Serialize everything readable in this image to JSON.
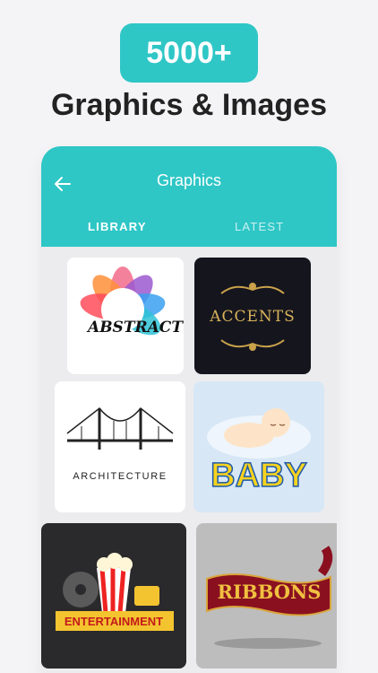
{
  "promo": {
    "badge": "5000+",
    "headline": "Graphics & Images"
  },
  "appbar": {
    "title": "Graphics",
    "back_icon": "arrow-left-icon",
    "tabs": [
      {
        "label": "LIBRARY",
        "active": true
      },
      {
        "label": "LATEST",
        "active": false
      }
    ]
  },
  "tiles": [
    {
      "label": "ABSTRACT"
    },
    {
      "label": "ACCENTS"
    },
    {
      "label": "ARCHITECTURE"
    },
    {
      "label": "BABY"
    },
    {
      "label": "ENTERTAINMENT"
    },
    {
      "label": "RIBBONS"
    }
  ],
  "colors": {
    "accent": "#2fc6c6",
    "headline": "#222222"
  }
}
